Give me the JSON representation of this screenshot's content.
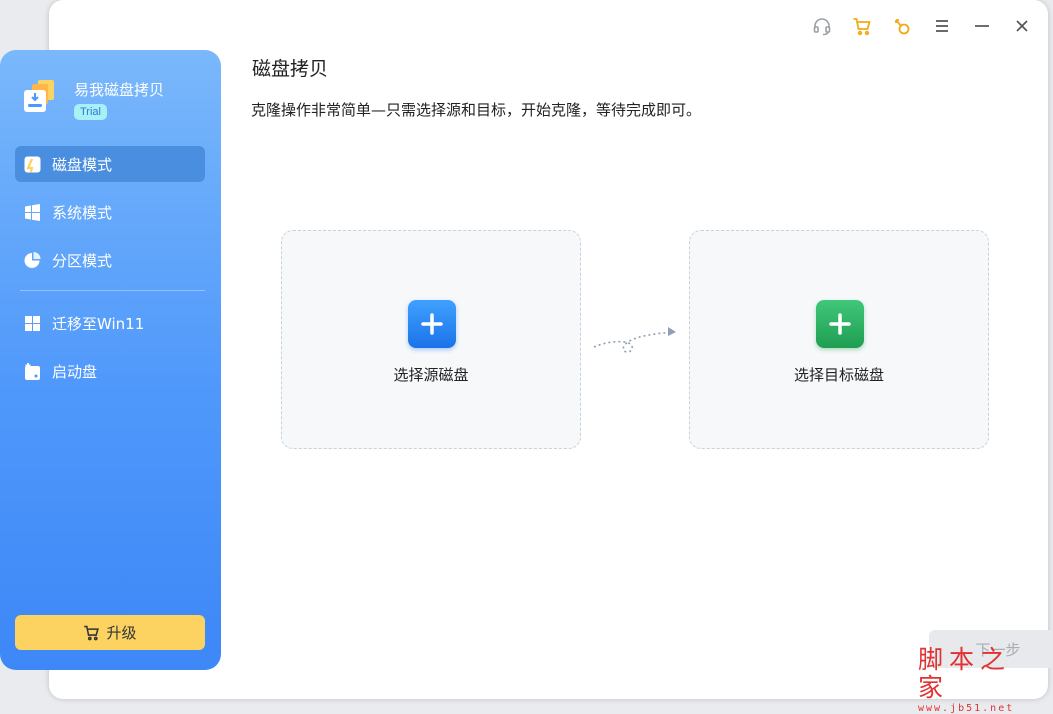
{
  "app": {
    "name": "易我磁盘拷贝",
    "badge": "Trial"
  },
  "titlebar": {
    "icons": [
      "headset-icon",
      "cart-icon",
      "key-icon",
      "menu-icon",
      "minimize-icon",
      "close-icon"
    ]
  },
  "sidebar": {
    "items": [
      {
        "label": "磁盘模式",
        "icon": "disk-mode-icon",
        "active": true
      },
      {
        "label": "系统模式",
        "icon": "windows-icon",
        "active": false
      },
      {
        "label": "分区模式",
        "icon": "pie-chart-icon",
        "active": false
      },
      {
        "label": "迁移至Win11",
        "icon": "win11-icon",
        "active": false
      },
      {
        "label": "启动盘",
        "icon": "boot-disk-icon",
        "active": false
      }
    ],
    "upgrade_label": "升级"
  },
  "main": {
    "title": "磁盘拷贝",
    "description": "克隆操作非常简单—只需选择源和目标，开始克隆，等待完成即可。",
    "source_label": "选择源磁盘",
    "target_label": "选择目标磁盘",
    "next_label": "下一步"
  },
  "watermark": {
    "main": "脚本之家",
    "sub": "www.jb51.net"
  },
  "colors": {
    "accent": "#4f98fb",
    "upgrade": "#fcd361",
    "source": "#1a73e8",
    "target": "#1f9e52"
  }
}
